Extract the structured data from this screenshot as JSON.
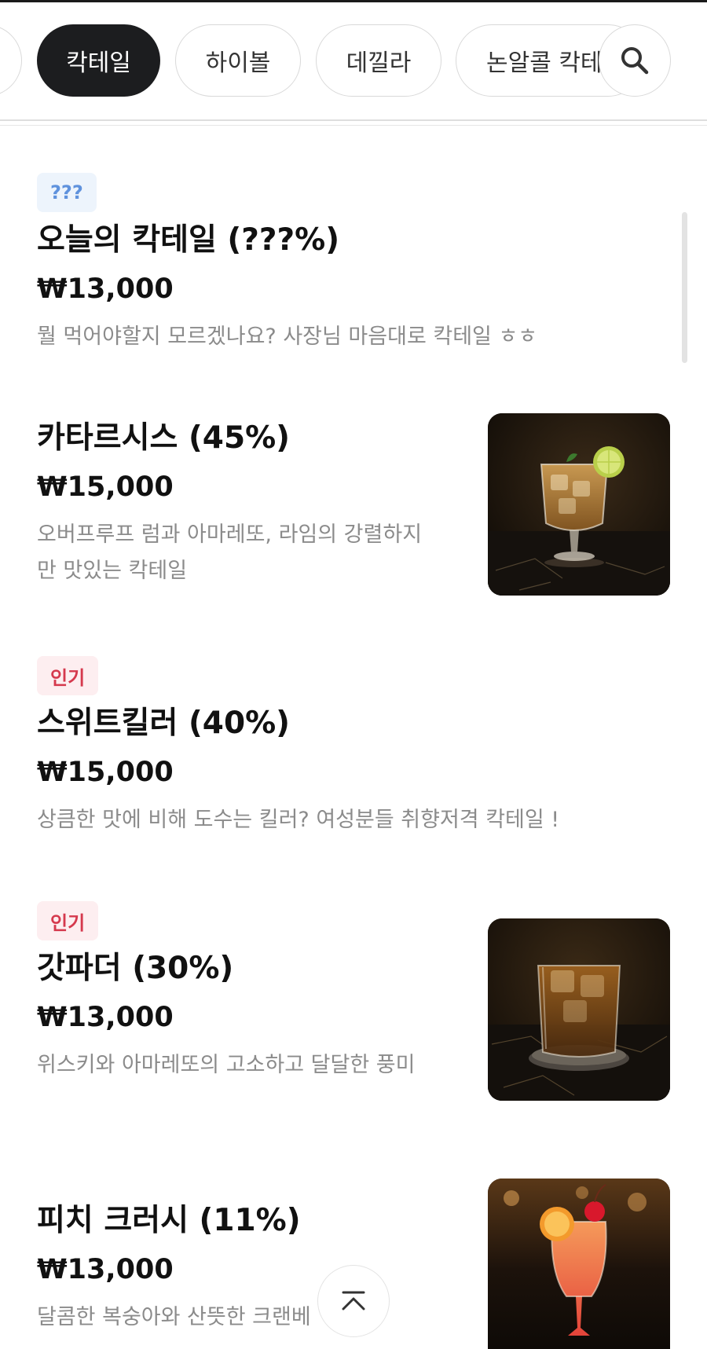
{
  "categories": {
    "items": [
      "칵테일",
      "하이볼",
      "데낄라",
      "논알콜 칵테일"
    ],
    "active": "칵테일"
  },
  "icons": {
    "search": "search-icon",
    "scroll_top": "chevron-up-icon"
  },
  "colors": {
    "active_chip": "#1c1d1f",
    "badge_blue": "#5f92dd",
    "badge_red": "#d5394d",
    "description": "#8b8b8b"
  },
  "menu": [
    {
      "badge": "???",
      "name": "오늘의 칵테일 (???%)",
      "price": "₩13,000",
      "description": "뭘 먹어야할지 모르겠나요? 사장님 마음대로 칵테일 ㅎㅎ"
    },
    {
      "name": "카타르시스 (45%)",
      "price": "₩15,000",
      "description": "오버프루프 럼과 아마레또, 라임의 강렬하지만 맛있는 칵테일"
    },
    {
      "badge": "인기",
      "name": "스위트킬러 (40%)",
      "price": "₩15,000",
      "description": "상큼한 맛에 비해 도수는 킬러? 여성분들 취향저격 칵테일 !"
    },
    {
      "badge": "인기",
      "name": "갓파더 (30%)",
      "price": "₩13,000",
      "description": "위스키와 아마레또의 고소하고 달달한 풍미"
    },
    {
      "name": "피치 크러시 (11%)",
      "price": "₩13,000",
      "description": "달콤한 복숭아와 산뜻한 크랜베"
    }
  ]
}
